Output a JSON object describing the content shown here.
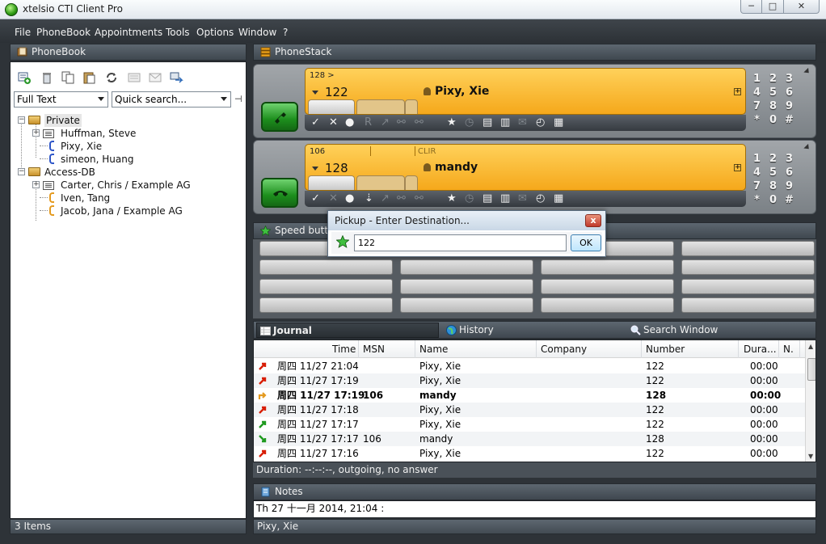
{
  "window": {
    "title": "xtelsio CTI Client Pro",
    "min": "─",
    "max": "□",
    "close": "✕"
  },
  "menu": [
    "File",
    "PhoneBook",
    "Appointments",
    "Tools",
    "Options",
    "Window",
    "?"
  ],
  "phonebook": {
    "header": "PhoneBook",
    "search_mode": "Full Text",
    "quick_search": "Quick search...",
    "pin": "⊣",
    "tree": [
      {
        "label": "Private"
      },
      {
        "label": "Huffman, Steve"
      },
      {
        "label": "Pixy, Xie"
      },
      {
        "label": "simeon, Huang"
      },
      {
        "label": "Access-DB"
      },
      {
        "label": "Carter, Chris  /  Example AG"
      },
      {
        "label": "Iven, Tang"
      },
      {
        "label": "Jacob, Jana  /  Example AG"
      }
    ],
    "status": "3 Items"
  },
  "phonestack": {
    "header": "PhoneStack",
    "calls": [
      {
        "top_left": "128 >",
        "top_mid": "",
        "top_right": "",
        "number": "122",
        "name": "Pixy, Xie",
        "state": "talking"
      },
      {
        "top_left": "106",
        "top_mid": "",
        "top_right": "CLIR",
        "number": "128",
        "name": "mandy",
        "state": "held"
      }
    ],
    "tools": [
      "✓",
      "✕",
      "●",
      "R",
      "↗",
      "⚯",
      "⚯",
      "★",
      "◷",
      "▤",
      "▥",
      "✉",
      "◴",
      "▦"
    ],
    "tools2": [
      "✓",
      "✕",
      "●",
      "⇣",
      "↗",
      "⚯",
      "⚯",
      "★",
      "◷",
      "▤",
      "▥",
      "✉",
      "◴",
      "▦"
    ],
    "keypad": [
      "1",
      "2",
      "3",
      "4",
      "5",
      "6",
      "7",
      "8",
      "9",
      "*",
      "0",
      "#"
    ]
  },
  "speed_buttons": {
    "header": "Speed butt"
  },
  "pickup_dialog": {
    "title": "Pickup - Enter Destination...",
    "value": "122",
    "ok": "OK",
    "close": "x"
  },
  "journal": {
    "tabs": [
      "Journal",
      "History",
      "Search Window"
    ],
    "columns": [
      "Time",
      "MSN",
      "Name",
      "Company",
      "Number",
      "Dura...",
      "N."
    ],
    "rows": [
      {
        "dir": "out-red",
        "time": "周四 11/27 21:04",
        "msn": "",
        "name": "Pixy, Xie",
        "company": "",
        "number": "122",
        "duration": "00:00",
        "bold": false
      },
      {
        "dir": "out-red",
        "time": "周四 11/27 17:19",
        "msn": "",
        "name": "Pixy, Xie",
        "company": "",
        "number": "122",
        "duration": "00:00",
        "bold": false
      },
      {
        "dir": "transfer",
        "time": "周四 11/27 17:19",
        "msn": "106",
        "name": "mandy",
        "company": "",
        "number": "128",
        "duration": "00:00",
        "bold": true
      },
      {
        "dir": "out-red",
        "time": "周四 11/27 17:18",
        "msn": "",
        "name": "Pixy, Xie",
        "company": "",
        "number": "122",
        "duration": "00:00",
        "bold": false
      },
      {
        "dir": "out-green",
        "time": "周四 11/27 17:17",
        "msn": "",
        "name": "Pixy, Xie",
        "company": "",
        "number": "122",
        "duration": "00:00",
        "bold": false
      },
      {
        "dir": "in-green",
        "time": "周四 11/27 17:17",
        "msn": "106",
        "name": "mandy",
        "company": "",
        "number": "128",
        "duration": "00:00",
        "bold": false
      },
      {
        "dir": "out-red",
        "time": "周四 11/27 17:16",
        "msn": "",
        "name": "Pixy, Xie",
        "company": "",
        "number": "122",
        "duration": "00:00",
        "bold": false
      }
    ],
    "status": "Duration: --:--:--, outgoing, no answer"
  },
  "notes": {
    "header": "Notes",
    "text": "Th 27 十一月 2014,  21:04  :",
    "status": "Pixy, Xie"
  },
  "colors": {
    "accent_orange": "#f5a81b",
    "call_green": "#1d8e1d",
    "panel_dark": "#2e3338"
  }
}
